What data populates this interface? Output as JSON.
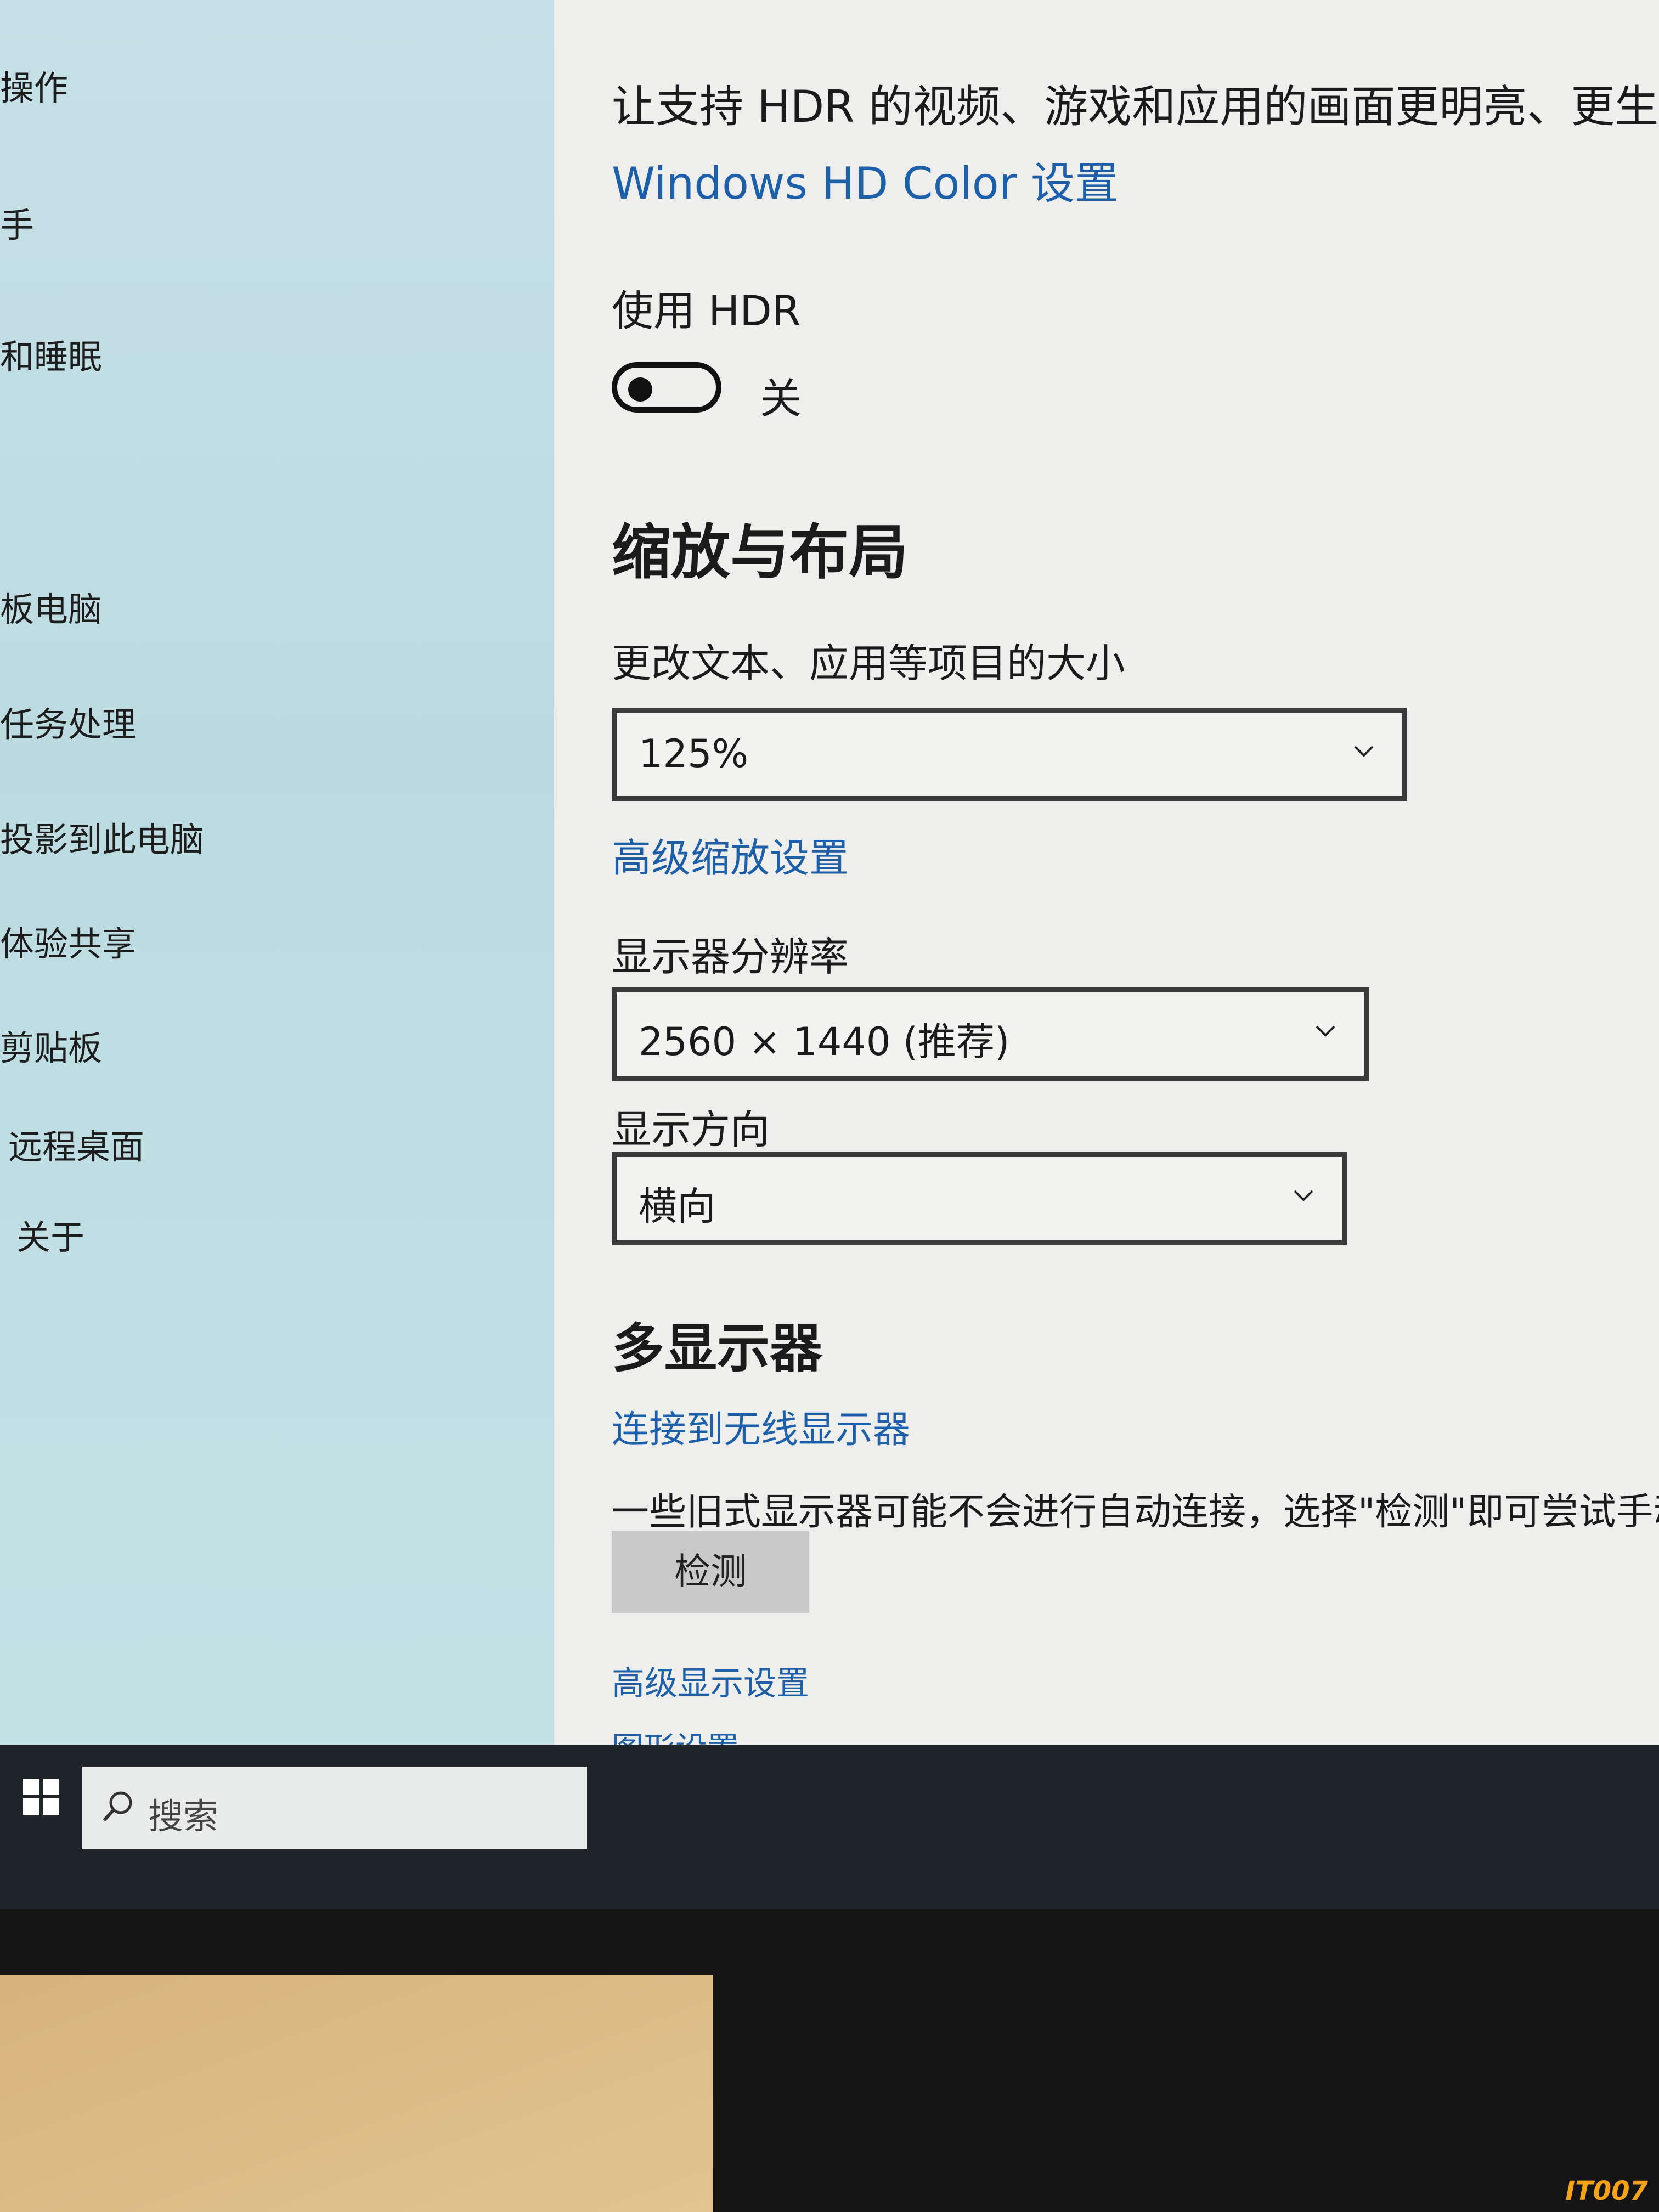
{
  "sidebar": {
    "items": [
      {
        "label": "操作"
      },
      {
        "label": "手"
      },
      {
        "label": "和睡眠"
      },
      {
        "label": "板电脑"
      },
      {
        "label": "任务处理"
      },
      {
        "label": "投影到此电脑"
      },
      {
        "label": "体验共享"
      },
      {
        "label": "剪贴板"
      },
      {
        "label": "远程桌面"
      },
      {
        "label": "关于"
      }
    ]
  },
  "hdr": {
    "description": "让支持 HDR 的视频、游戏和应用的画面更明亮、更生",
    "settings_link": "Windows HD Color 设置",
    "toggle_label": "使用 HDR",
    "toggle_state_text": "关",
    "toggle_on": false
  },
  "scale_layout": {
    "heading": "缩放与布局",
    "scale_label": "更改文本、应用等项目的大小",
    "scale_value": "125%",
    "advanced_scaling_link": "高级缩放设置",
    "resolution_label": "显示器分辨率",
    "resolution_value": "2560 × 1440 (推荐)",
    "orientation_label": "显示方向",
    "orientation_value": "横向"
  },
  "multi_display": {
    "heading": "多显示器",
    "wireless_link": "连接到无线显示器",
    "note": "一些旧式显示器可能不会进行自动连接，选择\"检测\"即可尝试手动连",
    "detect_button": "检测",
    "advanced_display_link": "高级显示设置",
    "graphics_link": "图形设置"
  },
  "taskbar": {
    "search_placeholder": "搜索",
    "icons": [
      "edge-icon",
      "file-explorer-icon",
      "store-icon",
      "settings-icon"
    ]
  },
  "watermark": "IT007"
}
